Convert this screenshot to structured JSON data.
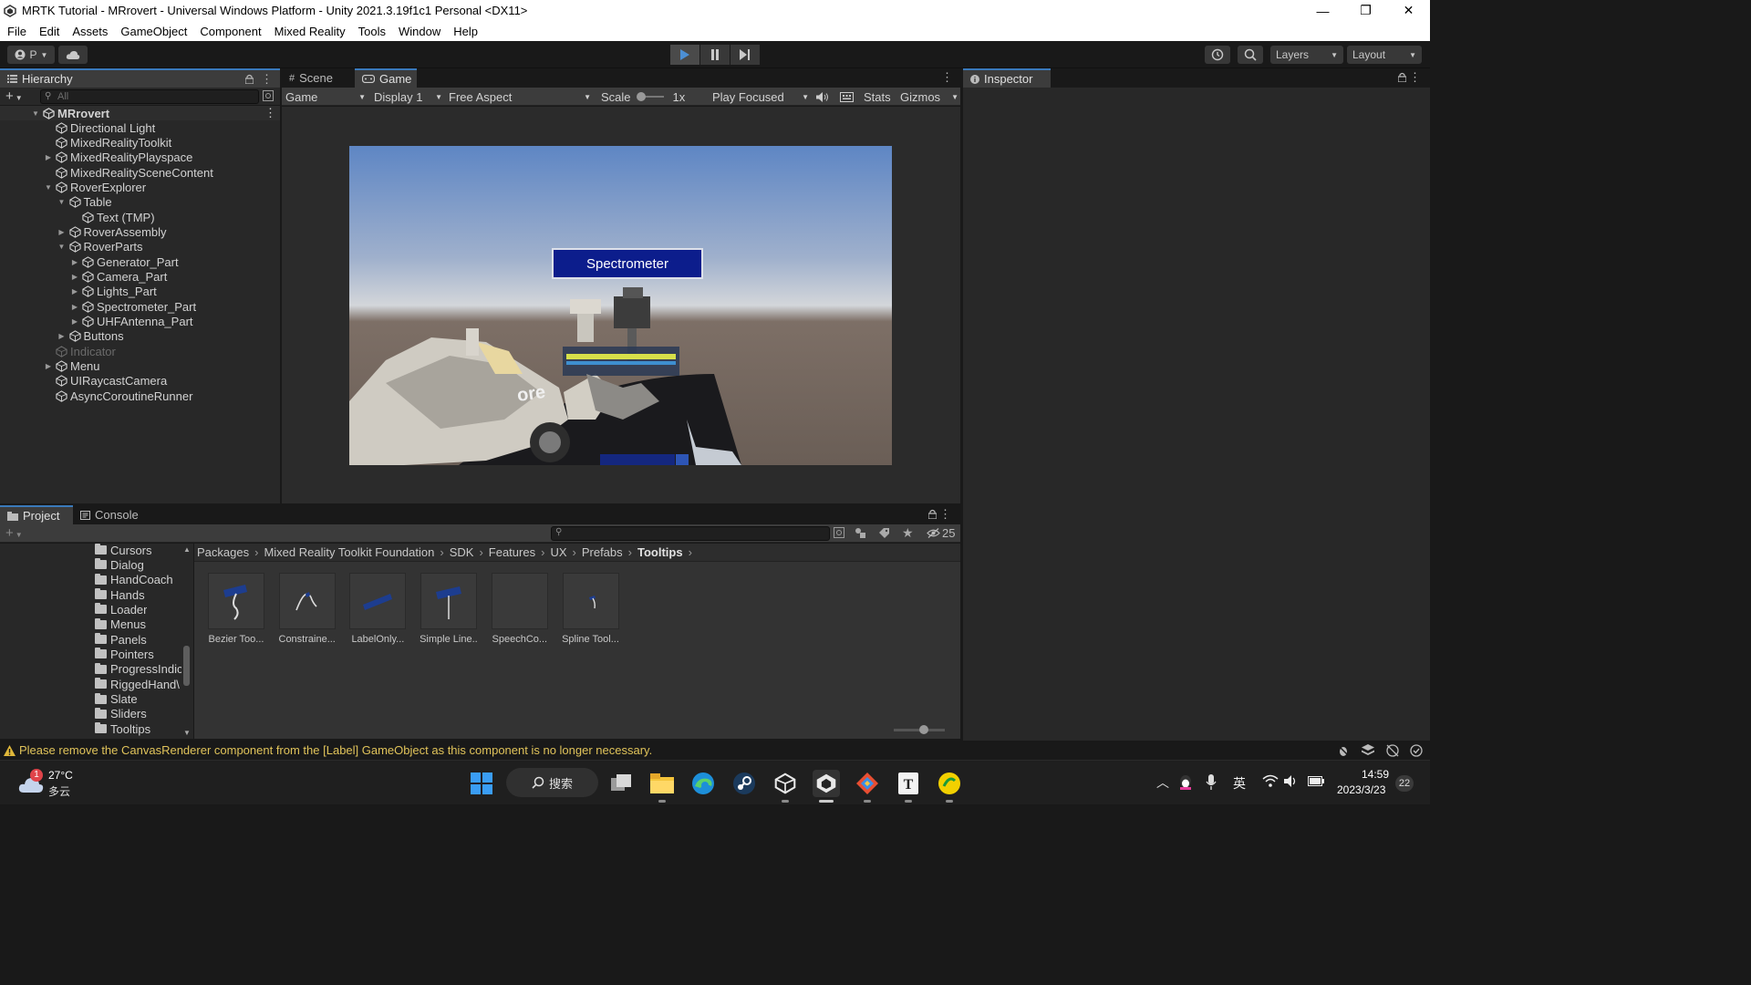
{
  "window": {
    "title": "MRTK Tutorial - MRrovert - Universal Windows Platform - Unity 2021.3.19f1c1 Personal <DX11>",
    "controls": [
      "—",
      "❐",
      "✕"
    ]
  },
  "menu": [
    "File",
    "Edit",
    "Assets",
    "GameObject",
    "Component",
    "Mixed Reality",
    "Tools",
    "Window",
    "Help"
  ],
  "toolbar": {
    "account_label": "P",
    "layers_label": "Layers",
    "layout_label": "Layout"
  },
  "hierarchy": {
    "tab_label": "Hierarchy",
    "search_placeholder": "All",
    "scene_name": "MRrovert",
    "items": [
      {
        "label": "Directional Light",
        "depth": 1,
        "arrow": "",
        "disabled": false
      },
      {
        "label": "MixedRealityToolkit",
        "depth": 1,
        "arrow": "",
        "disabled": false
      },
      {
        "label": "MixedRealityPlayspace",
        "depth": 1,
        "arrow": "▶",
        "disabled": false
      },
      {
        "label": "MixedRealitySceneContent",
        "depth": 1,
        "arrow": "",
        "disabled": false
      },
      {
        "label": "RoverExplorer",
        "depth": 1,
        "arrow": "▼",
        "disabled": false
      },
      {
        "label": "Table",
        "depth": 2,
        "arrow": "▼",
        "disabled": false
      },
      {
        "label": "Text (TMP)",
        "depth": 3,
        "arrow": "",
        "disabled": false
      },
      {
        "label": "RoverAssembly",
        "depth": 2,
        "arrow": "▶",
        "disabled": false
      },
      {
        "label": "RoverParts",
        "depth": 2,
        "arrow": "▼",
        "disabled": false
      },
      {
        "label": "Generator_Part",
        "depth": 3,
        "arrow": "▶",
        "disabled": false
      },
      {
        "label": "Camera_Part",
        "depth": 3,
        "arrow": "▶",
        "disabled": false
      },
      {
        "label": "Lights_Part",
        "depth": 3,
        "arrow": "▶",
        "disabled": false
      },
      {
        "label": "Spectrometer_Part",
        "depth": 3,
        "arrow": "▶",
        "disabled": false
      },
      {
        "label": "UHFAntenna_Part",
        "depth": 3,
        "arrow": "▶",
        "disabled": false
      },
      {
        "label": "Buttons",
        "depth": 2,
        "arrow": "▶",
        "disabled": false
      },
      {
        "label": "Indicator",
        "depth": 1,
        "arrow": "",
        "disabled": true
      },
      {
        "label": "Menu",
        "depth": 1,
        "arrow": "▶",
        "disabled": false
      },
      {
        "label": "UIRaycastCamera",
        "depth": 1,
        "arrow": "",
        "disabled": false
      },
      {
        "label": "AsyncCoroutineRunner",
        "depth": 1,
        "arrow": "",
        "disabled": false
      }
    ]
  },
  "center": {
    "tabs": [
      {
        "label": "Scene",
        "active": false
      },
      {
        "label": "Game",
        "active": true
      }
    ],
    "game_toolbar": {
      "mode": "Game",
      "display": "Display 1",
      "aspect": "Free Aspect",
      "scale_label": "Scale",
      "scale_value": "1x",
      "play_mode": "Play Focused",
      "stats": "Stats",
      "gizmos": "Gizmos"
    },
    "tooltip_text": "Spectrometer"
  },
  "inspector": {
    "tab_label": "Inspector"
  },
  "project": {
    "tabs": [
      {
        "label": "Project",
        "active": true
      },
      {
        "label": "Console",
        "active": false
      }
    ],
    "hidden_count": "25",
    "folders": [
      "Cursors",
      "Dialog",
      "HandCoach",
      "Hands",
      "Loader",
      "Menus",
      "Panels",
      "Pointers",
      "ProgressIndic",
      "RiggedHand\\",
      "Slate",
      "Sliders",
      "Tooltips"
    ],
    "breadcrumb": [
      "Packages",
      "Mixed Reality Toolkit Foundation",
      "SDK",
      "Features",
      "UX",
      "Prefabs",
      "Tooltips"
    ],
    "assets": [
      "Bezier Too...",
      "Constraine...",
      "LabelOnly...",
      "Simple Line...",
      "SpeechCo...",
      "Spline Tool..."
    ]
  },
  "status": {
    "message": "Please remove the CanvasRenderer component from the [Label] GameObject as this component is no longer necessary."
  },
  "taskbar": {
    "weather_temp": "27°C",
    "weather_desc": "多云",
    "weather_badge": "1",
    "search_label": "搜索",
    "ime": "英",
    "time": "14:59",
    "date": "2023/3/23",
    "notif_count": "22"
  }
}
